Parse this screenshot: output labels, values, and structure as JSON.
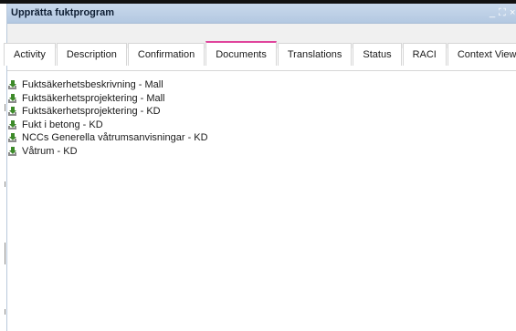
{
  "window": {
    "title": "Upprätta fuktprogram",
    "controls": {
      "minimize": "_",
      "maximize": "⛶",
      "close": "×"
    }
  },
  "tabs": [
    {
      "label": "Activity",
      "active": false
    },
    {
      "label": "Description",
      "active": false
    },
    {
      "label": "Confirmation",
      "active": false
    },
    {
      "label": "Documents",
      "active": true
    },
    {
      "label": "Translations",
      "active": false
    },
    {
      "label": "Status",
      "active": false
    },
    {
      "label": "RACI",
      "active": false
    },
    {
      "label": "Context View",
      "active": false
    }
  ],
  "documents": [
    {
      "label": "Fuktsäkerhetsbeskrivning - Mall",
      "icon": "document-download-icon"
    },
    {
      "label": "Fuktsäkerhetsprojektering - Mall",
      "icon": "document-download-icon"
    },
    {
      "label": "Fuktsäkerhetsprojektering - KD",
      "icon": "document-download-icon"
    },
    {
      "label": "Fukt i betong - KD",
      "icon": "document-download-icon"
    },
    {
      "label": "NCCs Generella våtrumsanvisningar - KD",
      "icon": "document-download-icon"
    },
    {
      "label": "Våtrum - KD",
      "icon": "document-download-icon"
    }
  ],
  "colors": {
    "titlebar": "#b3c8e1",
    "active_tab_accent": "#e0449c",
    "doc_icon": "#3d8a2a"
  }
}
